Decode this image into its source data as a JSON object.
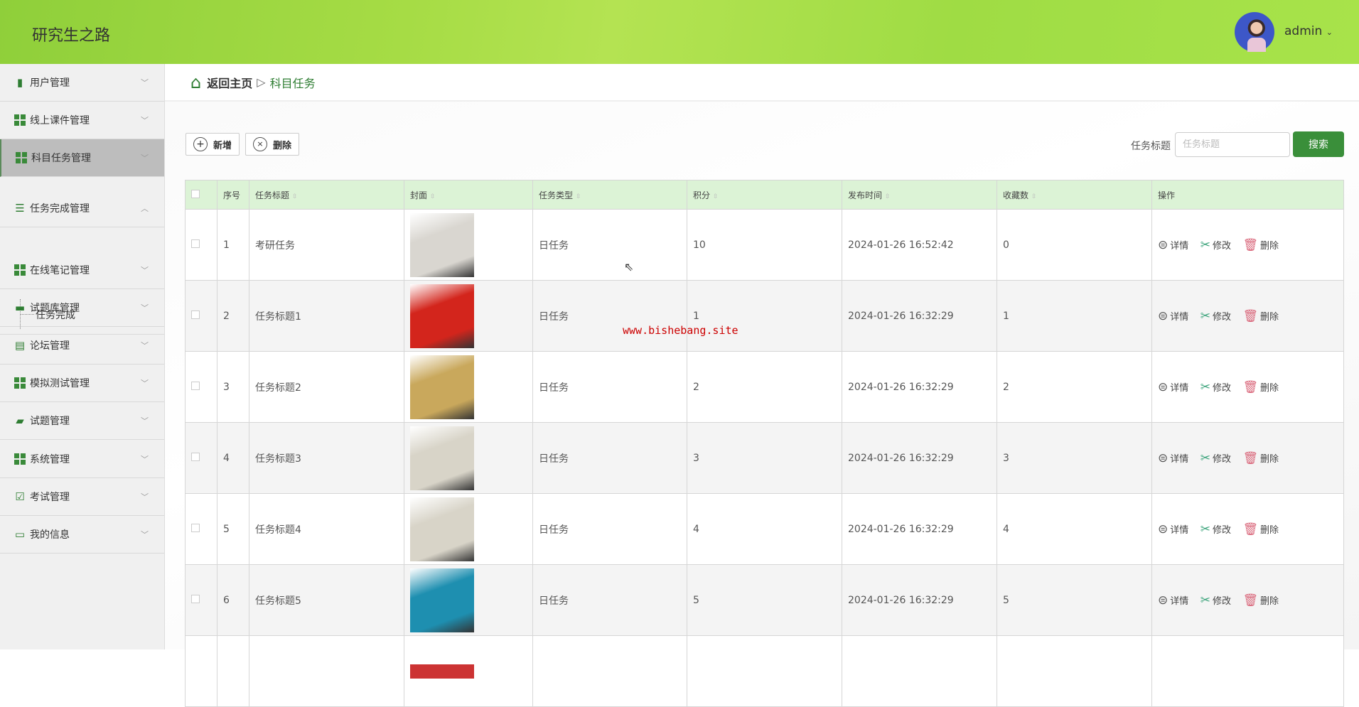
{
  "header": {
    "title": "研究生之路",
    "user": "admin"
  },
  "sidebar": {
    "items": [
      {
        "label": "用户管理",
        "icon": "brush-icon"
      },
      {
        "label": "线上课件管理",
        "icon": "grid-icon"
      },
      {
        "label": "科目任务管理",
        "icon": "grid-icon"
      },
      {
        "label": "任务完成管理",
        "icon": "list-icon"
      },
      {
        "label": "在线笔记管理",
        "icon": "grid-icon"
      },
      {
        "label": "试题库管理",
        "icon": "monitor-icon"
      },
      {
        "label": "论坛管理",
        "icon": "clipboard-icon"
      },
      {
        "label": "模拟测试管理",
        "icon": "grid-icon"
      },
      {
        "label": "试题管理",
        "icon": "wallet-icon"
      },
      {
        "label": "系统管理",
        "icon": "grid-icon"
      },
      {
        "label": "考试管理",
        "icon": "check-clipboard-icon"
      },
      {
        "label": "我的信息",
        "icon": "card-icon"
      }
    ],
    "submenu": {
      "label": "任务完成"
    }
  },
  "breadcrumb": {
    "home": "返回主页",
    "current": "科目任务"
  },
  "toolbar": {
    "add": "新增",
    "delete": "删除",
    "search_label": "任务标题",
    "search_placeholder": "任务标题",
    "search_value": "",
    "search_button": "搜索"
  },
  "table": {
    "headers": [
      "序号",
      "任务标题",
      "封面",
      "任务类型",
      "积分",
      "发布时间",
      "收藏数",
      "操作"
    ],
    "actions": {
      "detail": "详情",
      "edit": "修改",
      "delete": "删除"
    },
    "rows": [
      {
        "no": "1",
        "title": "考研任务",
        "type": "日任务",
        "points": "10",
        "time": "2024-01-26 16:52:42",
        "favs": "0",
        "cover": "#d9d6d0"
      },
      {
        "no": "2",
        "title": "任务标题1",
        "type": "日任务",
        "points": "1",
        "time": "2024-01-26 16:32:29",
        "favs": "1",
        "cover": "#d3251c"
      },
      {
        "no": "3",
        "title": "任务标题2",
        "type": "日任务",
        "points": "2",
        "time": "2024-01-26 16:32:29",
        "favs": "2",
        "cover": "#c9a85c"
      },
      {
        "no": "4",
        "title": "任务标题3",
        "type": "日任务",
        "points": "3",
        "time": "2024-01-26 16:32:29",
        "favs": "3",
        "cover": "#d8d4c8"
      },
      {
        "no": "5",
        "title": "任务标题4",
        "type": "日任务",
        "points": "4",
        "time": "2024-01-26 16:32:29",
        "favs": "4",
        "cover": "#d8d4c8"
      },
      {
        "no": "6",
        "title": "任务标题5",
        "type": "日任务",
        "points": "5",
        "time": "2024-01-26 16:32:29",
        "favs": "5",
        "cover": "#1e8fb0"
      }
    ]
  },
  "watermark": "www.bishebang.site"
}
